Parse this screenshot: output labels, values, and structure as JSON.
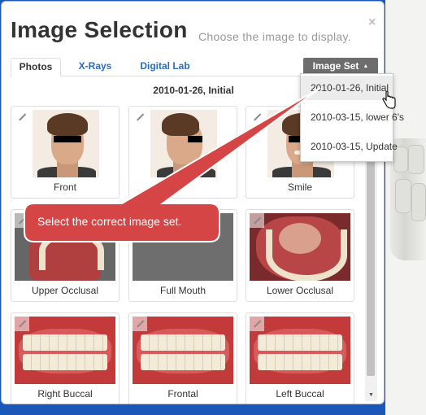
{
  "header": {
    "title": "Image Selection",
    "subtitle": "Choose the image to display.",
    "close_glyph": "×"
  },
  "tabs": [
    {
      "label": "Photos",
      "active": true
    },
    {
      "label": "X-Rays",
      "active": false
    },
    {
      "label": "Digital Lab",
      "active": false
    }
  ],
  "image_set_button": {
    "label": "Image Set",
    "caret_glyph": "▲"
  },
  "image_sets": [
    {
      "label": "2010-01-26, Initial",
      "highlighted": true
    },
    {
      "label": "2010-03-15, lower 6's",
      "highlighted": false
    },
    {
      "label": "2010-03-15, Update",
      "highlighted": false
    }
  ],
  "current_set": "2010-01-26, Initial",
  "photos": [
    {
      "label": "Front",
      "kind": "face-front"
    },
    {
      "label": "",
      "kind": "face-profile"
    },
    {
      "label": "Smile",
      "kind": "face-smile"
    },
    {
      "label": "Upper Occlusal",
      "kind": "occlusal-upper"
    },
    {
      "label": "Full Mouth",
      "kind": "blank"
    },
    {
      "label": "Lower Occlusal",
      "kind": "occlusal-lower"
    },
    {
      "label": "Right Buccal",
      "kind": "buccal"
    },
    {
      "label": "Frontal",
      "kind": "buccal"
    },
    {
      "label": "Left Buccal",
      "kind": "buccal"
    }
  ],
  "callout": {
    "text": "Select the correct image set."
  },
  "colors": {
    "accent": "#2a6cc0",
    "callout_fill": "#d64545",
    "background": "#1b57b8"
  },
  "icons": {
    "close": "close-icon",
    "expand": "expand-icon",
    "caret": "caret-up-icon",
    "cursor": "hand-pointer-icon"
  }
}
